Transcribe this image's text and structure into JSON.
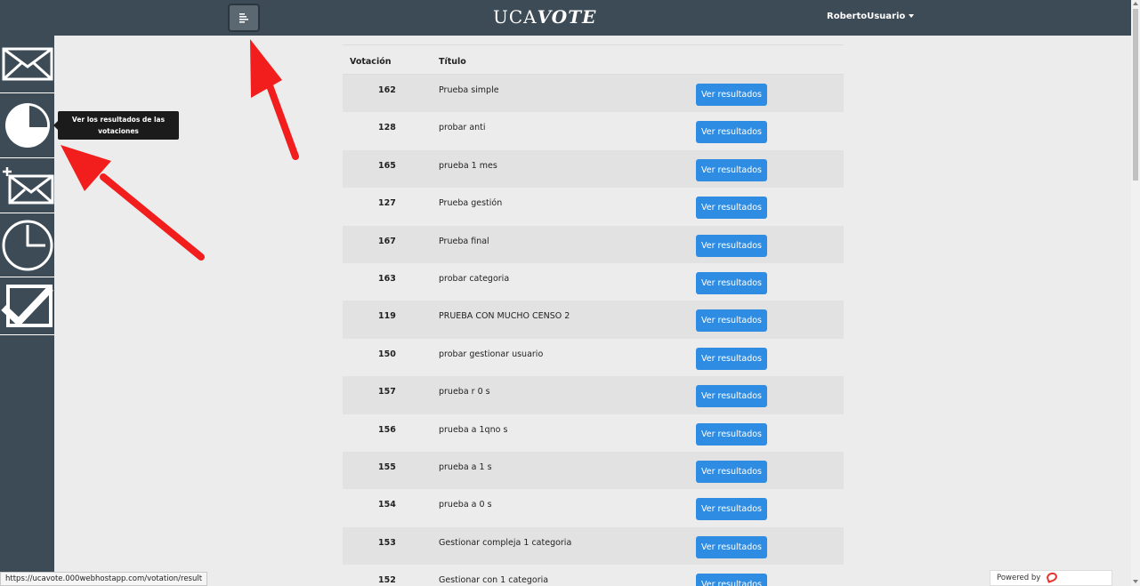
{
  "header": {
    "brand_prefix": "UCA",
    "brand_suffix": "VOTE",
    "user": "RobertoUsuario"
  },
  "sidebar": {
    "items": [
      {
        "icon": "envelope-icon"
      },
      {
        "icon": "pie-chart-icon"
      },
      {
        "icon": "add-envelope-icon"
      },
      {
        "icon": "clock-icon"
      },
      {
        "icon": "checkbox-icon"
      }
    ],
    "tooltip": "Ver los resultados de las votaciones"
  },
  "table": {
    "headers": {
      "votacion": "Votación",
      "titulo": "Título"
    },
    "button_label": "Ver resultados",
    "rows": [
      {
        "num": "162",
        "title": "Prueba simple"
      },
      {
        "num": "128",
        "title": "probar anti"
      },
      {
        "num": "165",
        "title": "prueba 1 mes"
      },
      {
        "num": "127",
        "title": "Prueba gestión"
      },
      {
        "num": "167",
        "title": "Prueba final"
      },
      {
        "num": "163",
        "title": "probar categoria"
      },
      {
        "num": "119",
        "title": "PRUEBA CON MUCHO CENSO 2"
      },
      {
        "num": "150",
        "title": "probar gestionar usuario"
      },
      {
        "num": "157",
        "title": "prueba r 0 s"
      },
      {
        "num": "156",
        "title": "prueba a 1qno s"
      },
      {
        "num": "155",
        "title": "prueba a 1 s"
      },
      {
        "num": "154",
        "title": "prueba a 0 s"
      },
      {
        "num": "153",
        "title": "Gestionar compleja 1 categoria"
      },
      {
        "num": "152",
        "title": "Gestionar con 1 categoria"
      }
    ]
  },
  "status_url": "https://ucavote.000webhostapp.com/votation/result",
  "footer": {
    "powered_by": "Powered by",
    "host": "000webhost"
  },
  "colors": {
    "topbar": "#3d4b56",
    "button": "#2e8de3",
    "arrow": "#f21d1d",
    "row_alt": "#e2e2e2"
  }
}
